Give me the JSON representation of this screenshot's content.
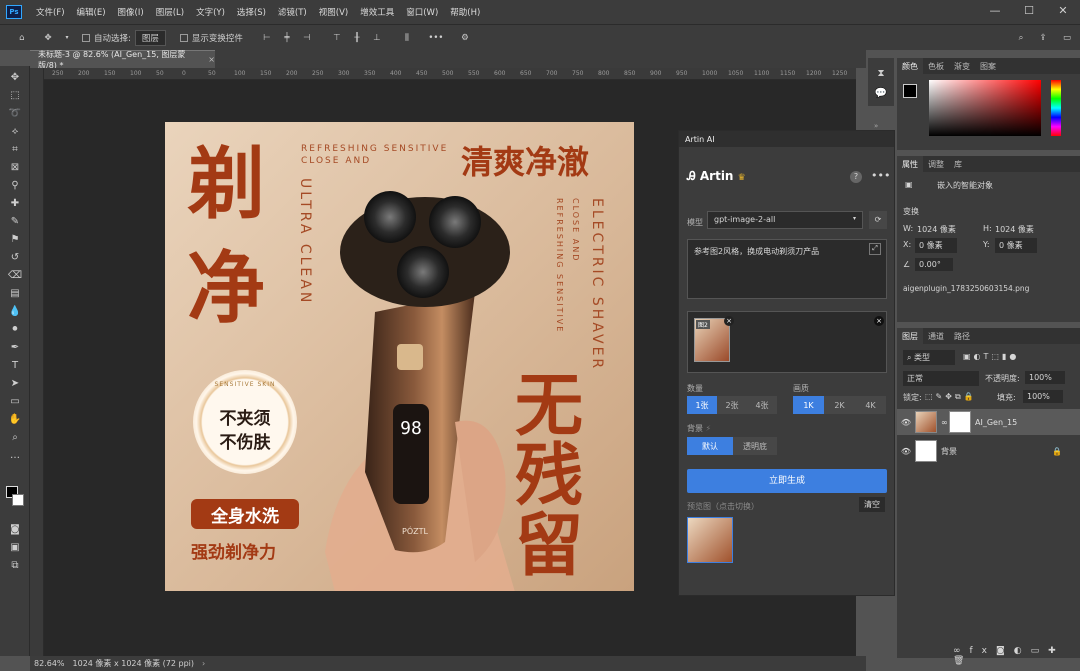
{
  "app": {
    "logo": "Ps",
    "menu": [
      "文件(F)",
      "编辑(E)",
      "图像(I)",
      "图层(L)",
      "文字(Y)",
      "选择(S)",
      "滤镜(T)",
      "视图(V)",
      "增效工具",
      "窗口(W)",
      "帮助(H)"
    ],
    "window_controls": [
      "—",
      "☐",
      "✕"
    ]
  },
  "options": {
    "auto_select_label": "自动选择:",
    "auto_select_value": "图层",
    "show_transform_label": "显示变换控件",
    "more": "•••"
  },
  "document": {
    "tab_title": "未标题-3 @ 82.6% (AI_Gen_15, 图层蒙版/8) *",
    "tab_close": "×",
    "ruler_ticks": [
      "250",
      "200",
      "150",
      "100",
      "50",
      "0",
      "50",
      "100",
      "150",
      "200",
      "250",
      "300",
      "350",
      "400",
      "450",
      "500",
      "550",
      "600",
      "650",
      "700",
      "750",
      "800",
      "850",
      "900",
      "950",
      "1000",
      "1050",
      "1100",
      "1150",
      "1200",
      "1250"
    ],
    "zoom": "82.64%",
    "dimensions": "1024 像素 x 1024 像素 (72 ppi)"
  },
  "artwork": {
    "big_left": [
      "剃",
      "净"
    ],
    "en_top": "REFRESHING SENSITIVE",
    "en_top2": "CLOSE AND",
    "en_vert_left": "ULTRA CLEAN",
    "title_right": "清爽净澈",
    "en_vert_right1": "REFRESHING SENSITIVE",
    "en_vert_right2": "CLOSE AND",
    "en_vert_right3": "ELECTRIC SHAVER",
    "big_right": [
      "无",
      "残",
      "留"
    ],
    "badge_ring": "SENSITIVE SKIN",
    "badge_line1": "不夹须",
    "badge_line2": "不伤肤",
    "pill1": "全身水洗",
    "pill2": "强劲剃净力",
    "brand": "PÓZTL",
    "display": "98"
  },
  "artin": {
    "panel_tab": "Artin AI",
    "title": "Artin",
    "crown": "♛",
    "help": "?",
    "more": "•••",
    "model_label": "模型",
    "model_value": "gpt-image-2-all",
    "prompt": "参考图2风格，换成电动剃须刀产品",
    "ref_badge": "图2",
    "qty_label": "数量",
    "qty_options": [
      "1张",
      "2张",
      "4张"
    ],
    "qty_selected": 0,
    "res_label": "画质",
    "res_options": [
      "1K",
      "2K",
      "4K"
    ],
    "res_selected": 0,
    "bg_label": "背景",
    "bg_options": [
      "默认",
      "透明底"
    ],
    "bg_selected": 0,
    "generate": "立即生成",
    "preview_label": "预览图（点击切换）",
    "clear": "清空"
  },
  "color_panel": {
    "tabs": [
      "颜色",
      "色板",
      "渐变",
      "图案"
    ],
    "accent": "#ff0000"
  },
  "properties": {
    "tabs": [
      "属性",
      "调整",
      "库"
    ],
    "object_type": "嵌入的智能对象",
    "transform_label": "变换",
    "w_label": "W:",
    "w_value": "1024 像素",
    "h_label": "H:",
    "h_value": "1024 像素",
    "x_label": "X:",
    "x_value": "0 像素",
    "y_label": "Y:",
    "y_value": "0 像素",
    "angle": "0.00°",
    "filename": "aigenplugin_1783250603154.png"
  },
  "layers": {
    "tabs": [
      "图层",
      "通道",
      "路径"
    ],
    "filter_label": "类型",
    "blend_mode": "正常",
    "opacity_label": "不透明度:",
    "opacity_value": "100%",
    "lock_label": "锁定:",
    "fill_label": "填充:",
    "fill_value": "100%",
    "items": [
      {
        "name": "AI_Gen_15",
        "selected": true
      },
      {
        "name": "背景",
        "selected": false
      }
    ],
    "footer": "fx"
  }
}
